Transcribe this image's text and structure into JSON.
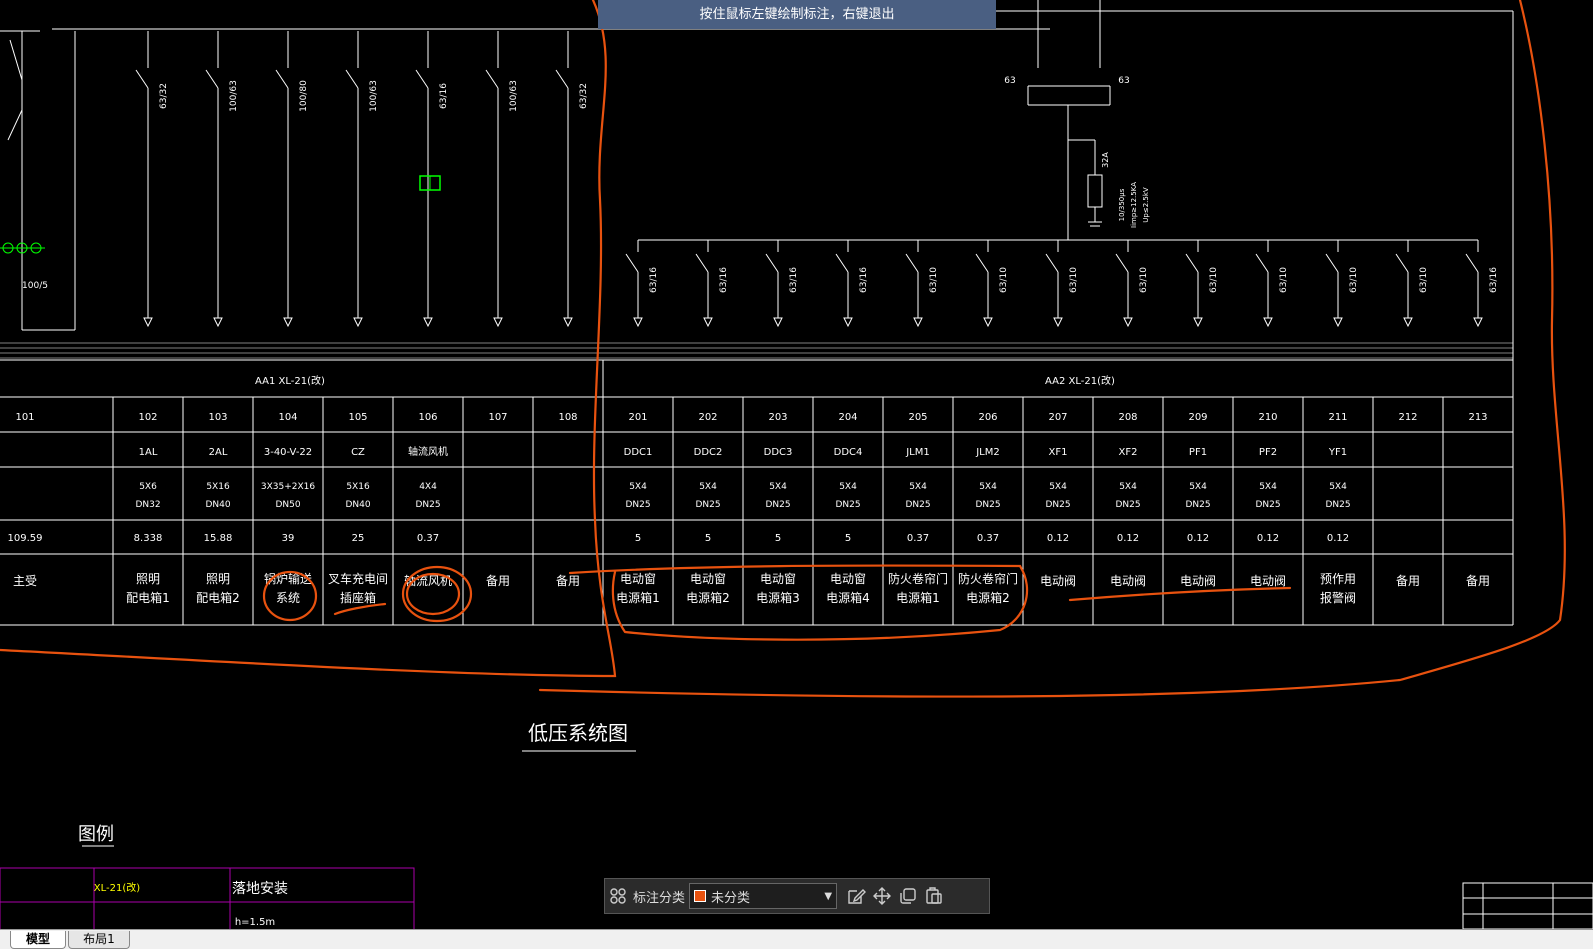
{
  "hint_bar": {
    "text": "按住鼠标左键绘制标注，右键退出"
  },
  "drawing": {
    "panel_left": "AA1   XL-21(改)",
    "panel_right": "AA2   XL-21(改)",
    "title": "低压系统图",
    "legend_title": "图例",
    "legend_row1_code": "XL-21(改)",
    "legend_row1_desc": "落地安装",
    "legend_row2_desc": "h=1.5m",
    "left_meter": "100/5",
    "right_breaker_left": "63",
    "right_breaker_right": "63",
    "spd_breaker": "32A",
    "spd_specs": [
      "10/350μs",
      "Iimp≥12.5KA",
      "Up≤2.5kV"
    ],
    "columns": [
      {
        "no": "101",
        "code": "",
        "cable": "",
        "pipe": "",
        "power": "109.59",
        "name1": "主受",
        "name2": "",
        "breaker": ""
      },
      {
        "no": "102",
        "code": "1AL",
        "cable": "5X6",
        "pipe": "DN32",
        "power": "8.338",
        "name1": "照明",
        "name2": "配电箱1",
        "breaker": "63/32"
      },
      {
        "no": "103",
        "code": "2AL",
        "cable": "5X16",
        "pipe": "DN40",
        "power": "15.88",
        "name1": "照明",
        "name2": "配电箱2",
        "breaker": "100/63"
      },
      {
        "no": "104",
        "code": "3-40-V-22",
        "cable": "3X35+2X16",
        "pipe": "DN50",
        "power": "39",
        "name1": "锅炉输送",
        "name2": "系统",
        "breaker": "100/80"
      },
      {
        "no": "105",
        "code": "CZ",
        "cable": "5X16",
        "pipe": "DN40",
        "power": "25",
        "name1": "叉车充电间",
        "name2": "插座箱",
        "breaker": "100/63"
      },
      {
        "no": "106",
        "code": "轴流风机",
        "cable": "4X4",
        "pipe": "DN25",
        "power": "0.37",
        "name1": "轴流风机",
        "name2": "",
        "breaker": "63/16"
      },
      {
        "no": "107",
        "code": "",
        "cable": "",
        "pipe": "",
        "power": "",
        "name1": "备用",
        "name2": "",
        "breaker": "100/63"
      },
      {
        "no": "108",
        "code": "",
        "cable": "",
        "pipe": "",
        "power": "",
        "name1": "备用",
        "name2": "",
        "breaker": "63/32"
      },
      {
        "no": "201",
        "code": "DDC1",
        "cable": "5X4",
        "pipe": "DN25",
        "power": "5",
        "name1": "电动窗",
        "name2": "电源箱1",
        "breaker": "63/16"
      },
      {
        "no": "202",
        "code": "DDC2",
        "cable": "5X4",
        "pipe": "DN25",
        "power": "5",
        "name1": "电动窗",
        "name2": "电源箱2",
        "breaker": "63/16"
      },
      {
        "no": "203",
        "code": "DDC3",
        "cable": "5X4",
        "pipe": "DN25",
        "power": "5",
        "name1": "电动窗",
        "name2": "电源箱3",
        "breaker": "63/16"
      },
      {
        "no": "204",
        "code": "DDC4",
        "cable": "5X4",
        "pipe": "DN25",
        "power": "5",
        "name1": "电动窗",
        "name2": "电源箱4",
        "breaker": "63/16"
      },
      {
        "no": "205",
        "code": "JLM1",
        "cable": "5X4",
        "pipe": "DN25",
        "power": "0.37",
        "name1": "防火卷帘门",
        "name2": "电源箱1",
        "breaker": "63/10"
      },
      {
        "no": "206",
        "code": "JLM2",
        "cable": "5X4",
        "pipe": "DN25",
        "power": "0.37",
        "name1": "防火卷帘门",
        "name2": "电源箱2",
        "breaker": "63/10"
      },
      {
        "no": "207",
        "code": "XF1",
        "cable": "5X4",
        "pipe": "DN25",
        "power": "0.12",
        "name1": "电动阀",
        "name2": "",
        "breaker": "63/10"
      },
      {
        "no": "208",
        "code": "XF2",
        "cable": "5X4",
        "pipe": "DN25",
        "power": "0.12",
        "name1": "电动阀",
        "name2": "",
        "breaker": "63/10"
      },
      {
        "no": "209",
        "code": "PF1",
        "cable": "5X4",
        "pipe": "DN25",
        "power": "0.12",
        "name1": "电动阀",
        "name2": "",
        "breaker": "63/10"
      },
      {
        "no": "210",
        "code": "PF2",
        "cable": "5X4",
        "pipe": "DN25",
        "power": "0.12",
        "name1": "电动阀",
        "name2": "",
        "breaker": "63/10"
      },
      {
        "no": "211",
        "code": "YF1",
        "cable": "5X4",
        "pipe": "DN25",
        "power": "0.12",
        "name1": "预作用",
        "name2": "报警阀",
        "breaker": "63/10"
      },
      {
        "no": "212",
        "code": "",
        "cable": "",
        "pipe": "",
        "power": "",
        "name1": "备用",
        "name2": "",
        "breaker": "63/10"
      },
      {
        "no": "213",
        "code": "",
        "cable": "",
        "pipe": "",
        "power": "",
        "name1": "备用",
        "name2": "",
        "breaker": "63/16"
      }
    ]
  },
  "annotation_toolbar": {
    "category_label": "标注分类",
    "category_value": "未分类",
    "category_color": "#e8520f"
  },
  "tabs": [
    {
      "label": "模型",
      "active": true
    },
    {
      "label": "布局1",
      "active": false
    }
  ],
  "colors": {
    "line": "#ffffff",
    "markup": "#e8520f",
    "highlight": "#00ff00",
    "legend_border": "#aa00aa",
    "legend_code": "#ffff00"
  }
}
